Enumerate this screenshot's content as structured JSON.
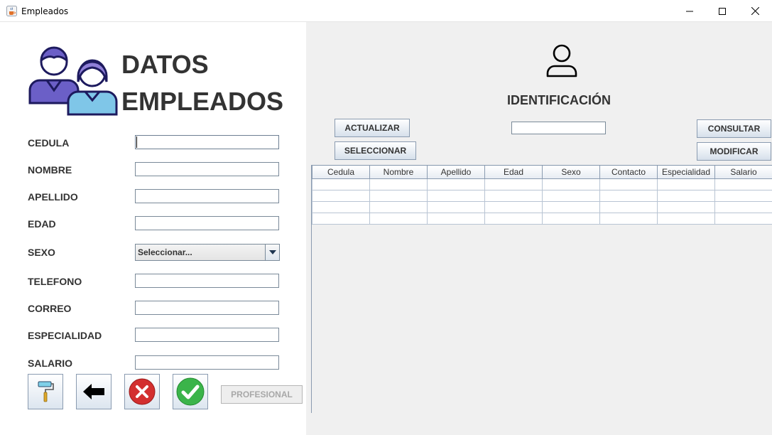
{
  "window": {
    "title": "Empleados",
    "icon": "java-cup-icon"
  },
  "header": {
    "title_line1": "DATOS",
    "title_line2": "EMPLEADOS",
    "icon": "employees-group-icon"
  },
  "form": {
    "fields": [
      {
        "label": "CEDULA",
        "value": ""
      },
      {
        "label": "NOMBRE",
        "value": ""
      },
      {
        "label": "APELLIDO",
        "value": ""
      },
      {
        "label": "EDAD",
        "value": ""
      },
      {
        "label": "SEXO",
        "value": "Seleccionar..."
      },
      {
        "label": "TELEFONO",
        "value": ""
      },
      {
        "label": "CORREO",
        "value": ""
      },
      {
        "label": "ESPECIALIDAD",
        "value": ""
      },
      {
        "label": "SALARIO",
        "value": ""
      }
    ]
  },
  "actions": {
    "clear_icon": "paint-roller-icon",
    "back_icon": "back-arrow-icon",
    "cancel_icon": "red-x-icon",
    "confirm_icon": "green-check-icon",
    "profesional_label": "PROFESIONAL"
  },
  "search": {
    "title": "IDENTIFICACIÓN",
    "icon": "user-icon",
    "input_value": "",
    "actualizar_label": "ACTUALIZAR",
    "seleccionar_label": "SELECCIONAR",
    "consultar_label": "CONSULTAR",
    "modificar_label": "MODIFICAR"
  },
  "table": {
    "columns": [
      "Cedula",
      "Nombre",
      "Apellido",
      "Edad",
      "Sexo",
      "Contacto",
      "Especialidad",
      "Salario"
    ],
    "rows": [
      [
        "",
        "",
        "",
        "",
        "",
        "",
        "",
        ""
      ],
      [
        "",
        "",
        "",
        "",
        "",
        "",
        "",
        ""
      ],
      [
        "",
        "",
        "",
        "",
        "",
        "",
        "",
        ""
      ],
      [
        "",
        "",
        "",
        "",
        "",
        "",
        "",
        ""
      ]
    ]
  },
  "colors": {
    "accent_purple": "#6b5fc7",
    "button_gradient_bottom": "#d6e0eb",
    "border": "#8a9bb0"
  }
}
